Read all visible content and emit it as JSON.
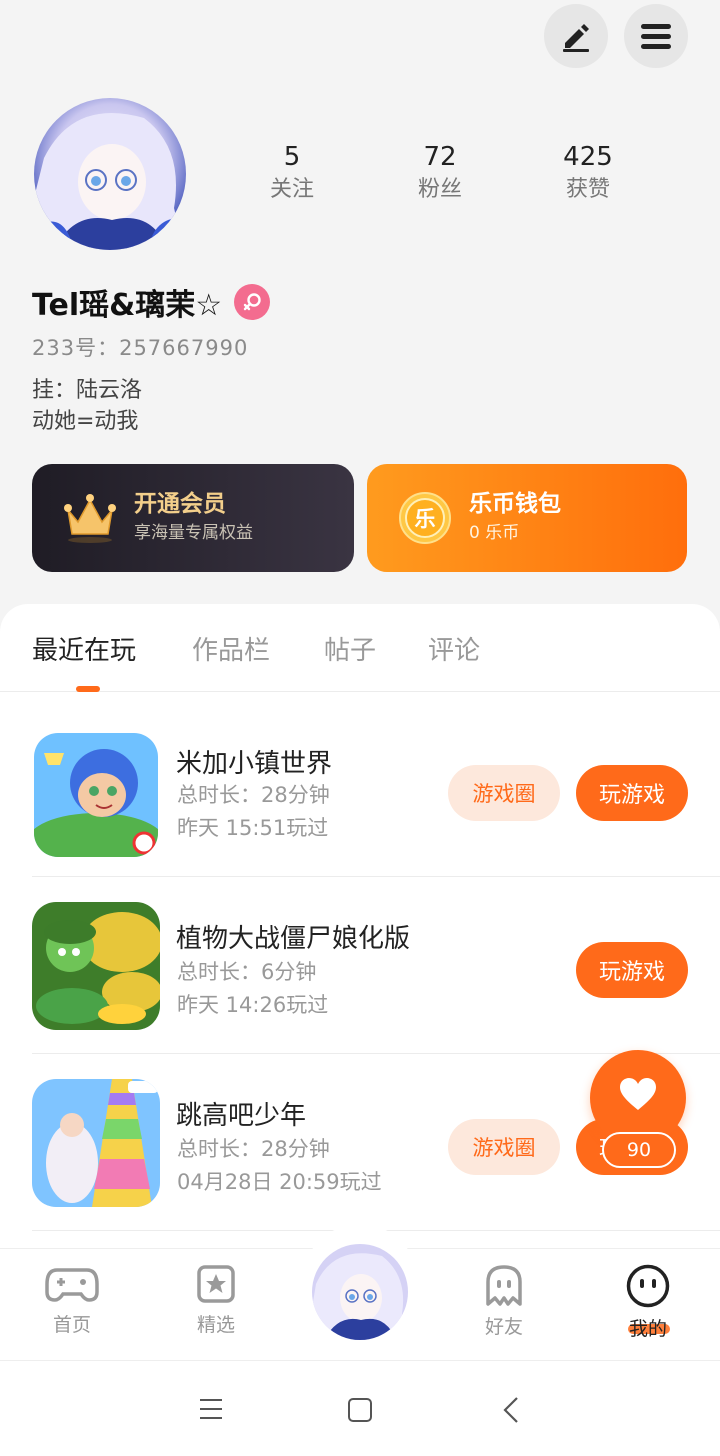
{
  "profile": {
    "stats": [
      {
        "value": "5",
        "label": "关注"
      },
      {
        "value": "72",
        "label": "粉丝"
      },
      {
        "value": "425",
        "label": "获赞"
      }
    ],
    "name": "Tel瑶&璃茉☆",
    "uid": "233号：257667990",
    "bio_line1": "挂：陆云洛",
    "bio_line2": "动她=动我"
  },
  "cards": {
    "vip_title": "开通会员",
    "vip_sub": "享海量专属权益",
    "coin_badge": "乐",
    "coin_title": "乐币钱包",
    "coin_sub": "0 乐币"
  },
  "tabs": [
    "最近在玩",
    "作品栏",
    "帖子",
    "评论"
  ],
  "games": [
    {
      "title": "米加小镇世界",
      "duration": "总时长：28分钟",
      "last_played": "昨天 15:51玩过",
      "circle_label": "游戏圈",
      "play_label": "玩游戏"
    },
    {
      "title": "植物大战僵尸娘化版",
      "duration": "总时长：6分钟",
      "last_played": "昨天 14:26玩过",
      "play_label": "玩游戏"
    },
    {
      "title": "跳高吧少年",
      "duration": "总时长：28分钟",
      "last_played": "04月28日 20:59玩过",
      "circle_label": "游戏圈",
      "play_label": "玩游戏"
    }
  ],
  "favorite": {
    "count": "90"
  },
  "bottom_nav": [
    {
      "label": "首页",
      "icon": "gamepad-icon"
    },
    {
      "label": "精选",
      "icon": "star-card-icon"
    },
    {
      "label": "",
      "icon": "avatar"
    },
    {
      "label": "好友",
      "icon": "ghost-icon"
    },
    {
      "label": "我的",
      "icon": "smiley-icon"
    }
  ],
  "colors": {
    "accent": "#ff6a1a",
    "gender": "#f36c8f",
    "vip_gold": "#f3cf8b"
  }
}
